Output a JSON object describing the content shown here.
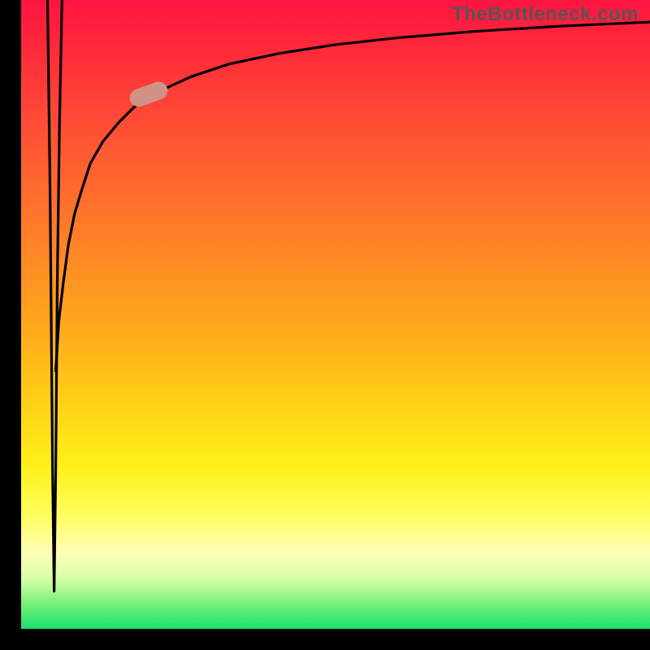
{
  "watermark": "TheBottleneck.com",
  "colors": {
    "frame": "#000000",
    "curve": "#000000",
    "marker": "#cf9287",
    "watermark_text": "#555555"
  },
  "chart_data": {
    "type": "line",
    "title": "",
    "xlabel": "",
    "ylabel": "",
    "xlim": [
      0,
      100
    ],
    "ylim": [
      0,
      100
    ],
    "grid": false,
    "legend": false,
    "series": [
      {
        "name": "down-spike",
        "comment": "Vertical dip near left edge; plunges from top to near bottom and back up",
        "x": [
          4.2,
          4.6,
          5.0,
          5.25,
          5.5,
          5.75,
          6.1,
          6.5
        ],
        "values": [
          100,
          70,
          25,
          6,
          25,
          55,
          80,
          100
        ]
      },
      {
        "name": "log-curve",
        "comment": "Logarithmic-looking rise from lower-left toward upper-right",
        "x": [
          5.5,
          6.0,
          6.7,
          7.5,
          8.5,
          9.7,
          11,
          13,
          15.5,
          18,
          22,
          27,
          33,
          41,
          50,
          60,
          72,
          85,
          100
        ],
        "values": [
          41,
          49,
          55,
          61,
          66,
          70,
          74,
          77.5,
          80.5,
          83,
          85.5,
          87.8,
          89.8,
          91.5,
          92.9,
          94.0,
          95.0,
          95.8,
          96.5
        ]
      }
    ],
    "marker": {
      "comment": "pill on the log-curve around x≈20, y≈85",
      "x": 20.3,
      "y": 85.0,
      "rotation_deg": -20
    }
  }
}
